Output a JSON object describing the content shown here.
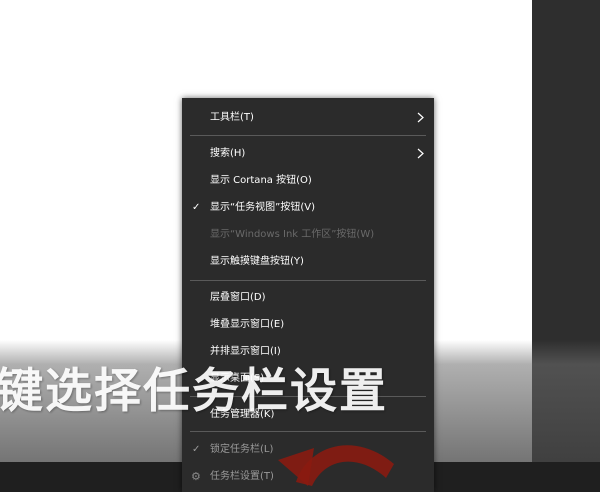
{
  "menu": {
    "items": [
      {
        "label": "工具栏(T)",
        "submenu": true
      },
      {
        "label": "搜索(H)",
        "submenu": true
      },
      {
        "label": "显示 Cortana 按钮(O)"
      },
      {
        "label": "显示“任务视图”按钮(V)",
        "checked": true
      },
      {
        "label": "显示“Windows Ink 工作区”按钮(W)",
        "disabled": true
      },
      {
        "label": "显示触摸键盘按钮(Y)"
      },
      {
        "label": "层叠窗口(D)"
      },
      {
        "label": "堆叠显示窗口(E)"
      },
      {
        "label": "并排显示窗口(I)"
      },
      {
        "label": "显示桌面(S)"
      },
      {
        "label": "任务管理器(K)"
      },
      {
        "label": "锁定任务栏(L)",
        "checked": true
      },
      {
        "label": "任务栏设置(T)",
        "icon": "gear-icon"
      }
    ]
  },
  "caption": {
    "text": "键选择任务栏设置"
  },
  "colors": {
    "menu_bg": "#2b2b2b",
    "menu_text": "#ffffff",
    "disabled_text": "#6a6a6a",
    "separator": "#5a5a5a",
    "arrow_red": "#8b1a10"
  }
}
